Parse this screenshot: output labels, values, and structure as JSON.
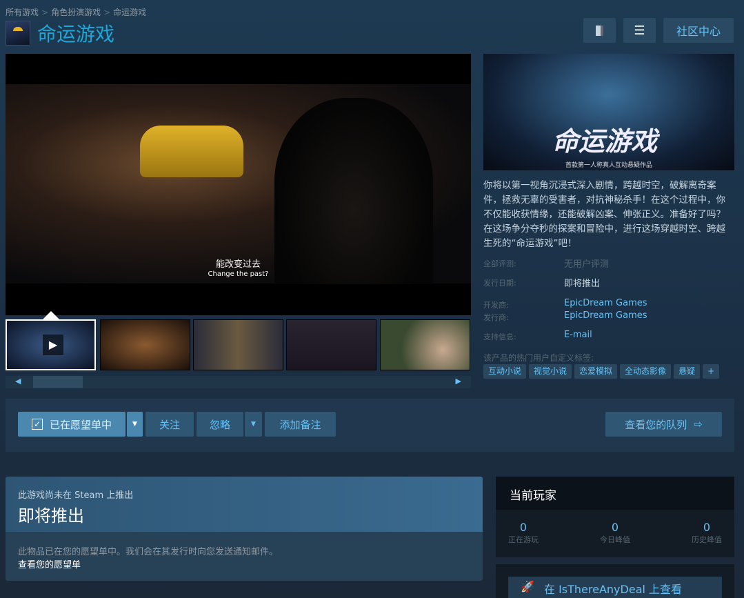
{
  "breadcrumb": [
    "所有游戏",
    "角色扮演游戏",
    "命运游戏"
  ],
  "title": "命运游戏",
  "header_buttons": {
    "community_hub": "社区中心"
  },
  "video": {
    "subtitle_cn": "能改变过去",
    "subtitle_en": "Change the past?"
  },
  "capsule": {
    "logo": "命运游戏",
    "tagline": "首款第一人称真人互动悬疑作品"
  },
  "description": "你将以第一视角沉浸式深入剧情，跨越时空，破解离奇案件，拯救无辜的受害者，对抗神秘杀手！在这个过程中，你不仅能收获情缘，还能破解凶案、伸张正义。准备好了吗？在这场争分夺秒的探案和冒险中，进行这场穿越时空、跨越生死的“命运游戏”吧！",
  "info": {
    "reviews_label": "全部评测:",
    "reviews_value": "无用户评测",
    "release_label": "发行日期:",
    "release_value": "即将推出",
    "developer_label": "开发商:",
    "developer_value": "EpicDream Games",
    "publisher_label": "发行商:",
    "publisher_value": "EpicDream Games",
    "support_label": "支持信息:",
    "support_value": "E-mail"
  },
  "tags_label": "该产品的热门用户自定义标签:",
  "tags": [
    "互动小说",
    "视觉小说",
    "恋爱模拟",
    "全动态影像",
    "悬疑",
    "+"
  ],
  "actions": {
    "wishlist": "已在愿望单中",
    "follow": "关注",
    "ignore": "忽略",
    "add_note": "添加备注",
    "view_queue": "查看您的队列"
  },
  "coming": {
    "note": "此游戏尚未在 Steam 上推出",
    "title": "即将推出",
    "body": "此物品已在您的愿望单中。我们会在其发行时向您发送通知邮件。",
    "link": "查看您的愿望单"
  },
  "players": {
    "title": "当前玩家",
    "stats": [
      {
        "value": "0",
        "label": "正在游玩"
      },
      {
        "value": "0",
        "label": "今日峰值"
      },
      {
        "value": "0",
        "label": "历史峰值"
      }
    ]
  },
  "itad": "在 IsThereAnyDeal 上查看"
}
